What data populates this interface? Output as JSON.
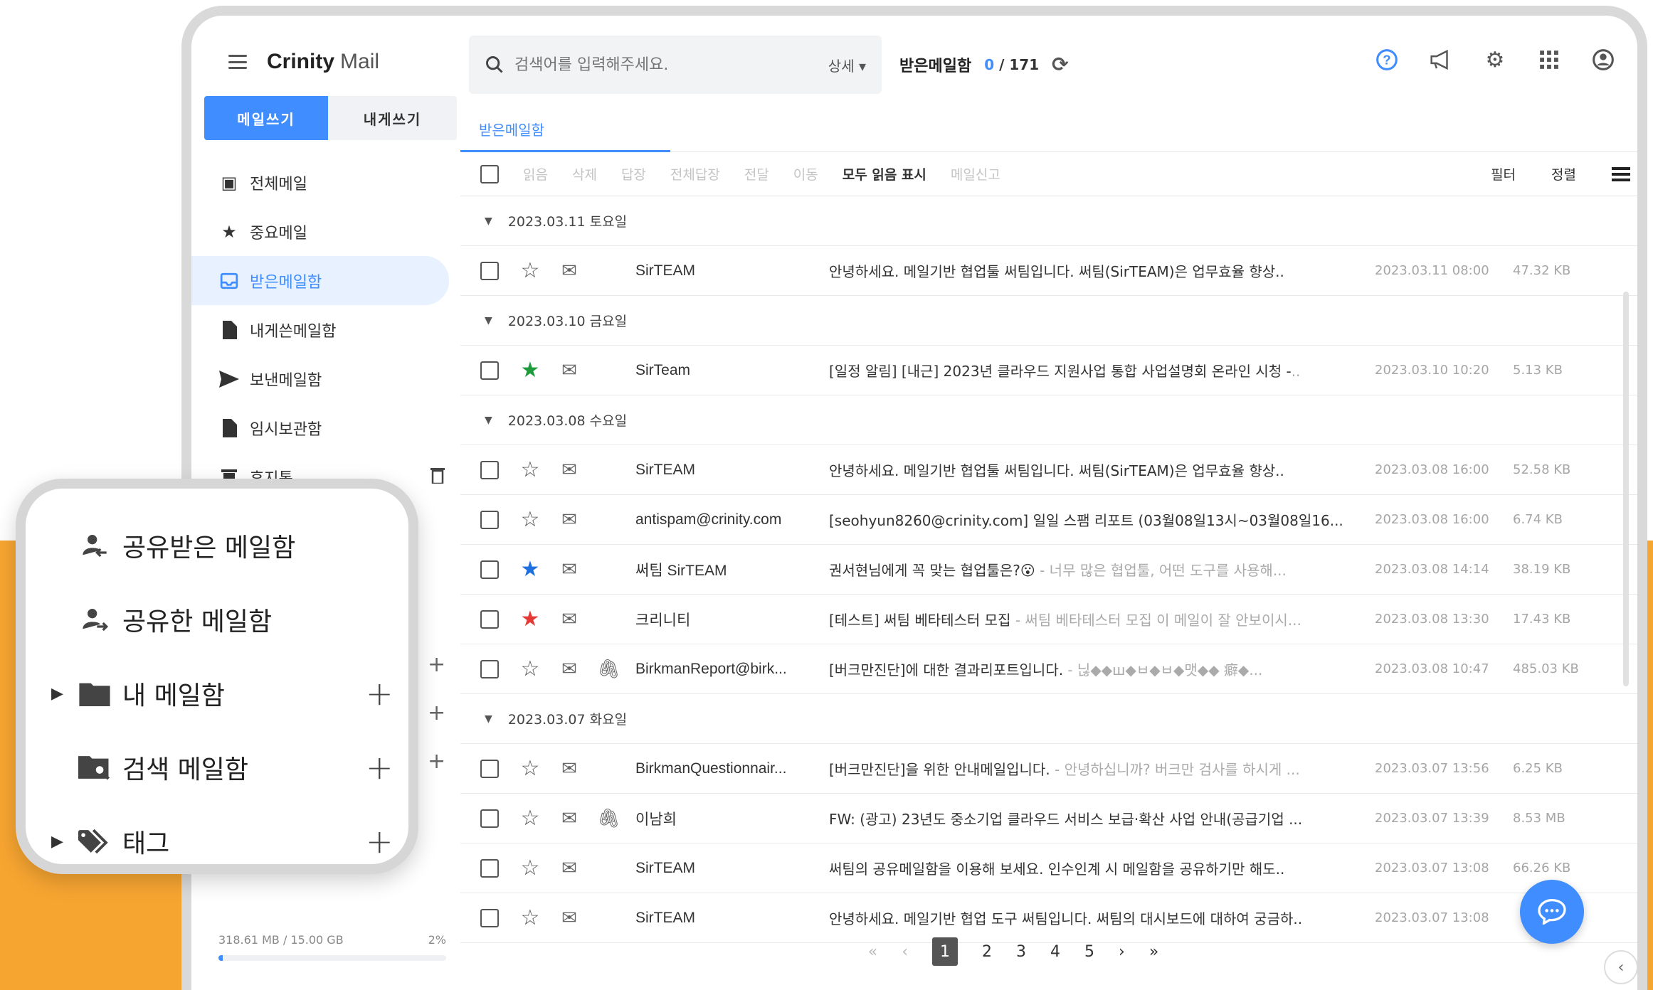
{
  "app": {
    "brand": "Crinity",
    "brand_sub": "Mail"
  },
  "compose": {
    "write_label": "메일쓰기",
    "self_label": "내게쓰기"
  },
  "sidebar": {
    "items": [
      {
        "label": "전체메일",
        "icon": "all-mail-icon"
      },
      {
        "label": "중요메일",
        "icon": "star-icon"
      },
      {
        "label": "받은메일함",
        "icon": "inbox-icon"
      },
      {
        "label": "내게쓴메일함",
        "icon": "document-icon"
      },
      {
        "label": "보낸메일함",
        "icon": "send-icon"
      },
      {
        "label": "임시보관함",
        "icon": "draft-icon"
      },
      {
        "label": "휴지통",
        "icon": "trash-icon"
      }
    ],
    "storage_used": "318.61 MB / 15.00 GB",
    "storage_pct": "2%",
    "storage_fraction": 0.02
  },
  "search": {
    "placeholder": "검색어를 입력해주세요.",
    "detail_label": "상세 ▾"
  },
  "mailbox": {
    "title": "받은메일함",
    "unread": "0",
    "total": "/ 171"
  },
  "tab": {
    "label": "받은메일함"
  },
  "toolbar": {
    "read": "읽음",
    "delete": "삭제",
    "reply": "답장",
    "reply_all": "전체답장",
    "forward": "전달",
    "move": "이동",
    "mark_all_read": "모두 읽음 표시",
    "report_spam": "메일신고",
    "filter": "필터",
    "sort": "정렬"
  },
  "groups": [
    {
      "date": "2023.03.11 토요일",
      "mails": [
        {
          "star": "none",
          "attach": false,
          "sender": "SirTEAM",
          "subject": "안녕하세요. 메일기반 협업툴 써팀입니다. 써팀(SirTEAM)은 업무효율 향상..",
          "preview": "",
          "date": "2023.03.11 08:00",
          "size": "47.32 KB"
        }
      ]
    },
    {
      "date": "2023.03.10 금요일",
      "mails": [
        {
          "star": "green",
          "attach": false,
          "sender": "SirTeam",
          "subject": "[일정 알림] [내근] 2023년 클라우드 지원사업 통합 사업설명회 온라인 시청 -",
          "preview": "..",
          "date": "2023.03.10 10:20",
          "size": "5.13 KB"
        }
      ]
    },
    {
      "date": "2023.03.08 수요일",
      "mails": [
        {
          "star": "none",
          "attach": false,
          "sender": "SirTEAM",
          "subject": "안녕하세요. 메일기반 협업툴 써팀입니다. 써팀(SirTEAM)은 업무효율 향상..",
          "preview": "",
          "date": "2023.03.08 16:00",
          "size": "52.58 KB"
        },
        {
          "star": "none",
          "attach": false,
          "sender": "antispam@crinity.com",
          "subject": "[seohyun8260@crinity.com] 일일 스팸 리포트 (03월08일13시~03월08일16...",
          "preview": "",
          "date": "2023.03.08 16:00",
          "size": "6.74 KB"
        },
        {
          "star": "blue",
          "attach": false,
          "sender": "써팀 SirTEAM",
          "subject": "권서현님에게 꼭 맞는 협업툴은?😮",
          "preview": " - 너무 많은 협업툴, 어떤 도구를 사용해...",
          "date": "2023.03.08 14:14",
          "size": "38.19 KB"
        },
        {
          "star": "red",
          "attach": false,
          "sender": "크리니티",
          "subject": "[테스트] 써팀 베타테스터 모집",
          "preview": " - 써팀 베타테스터 모집 이 메일이 잘 안보이시...",
          "date": "2023.03.08 13:30",
          "size": "17.43 KB"
        },
        {
          "star": "none",
          "attach": true,
          "sender": "BirkmanReport@birk...",
          "subject": "[버크만진단]에 대한 결과리포트입니다.",
          "preview": " - 닎◆◆ш◆ㅂ◆ㅂ◆맷◆◆ 癖◆...",
          "date": "2023.03.08 10:47",
          "size": "485.03 KB"
        }
      ]
    },
    {
      "date": "2023.03.07 화요일",
      "mails": [
        {
          "star": "none",
          "attach": false,
          "sender": "BirkmanQuestionnair...",
          "subject": "[버크만진단]을 위한 안내메일입니다.",
          "preview": " - 안녕하십니까? 버크만 검사를 하시게 ...",
          "date": "2023.03.07 13:56",
          "size": "6.25 KB"
        },
        {
          "star": "none",
          "attach": true,
          "sender": "이남희",
          "subject": "FW: (광고) 23년도 중소기업 클라우드 서비스 보급·확산 사업 안내(공급기업 ...",
          "preview": "",
          "date": "2023.03.07 13:39",
          "size": "8.53 MB"
        },
        {
          "star": "none",
          "attach": false,
          "sender": "SirTEAM",
          "subject": "써팀의 공유메일함을 이용해 보세요. 인수인계 시 메일함을 공유하기만 해도..",
          "preview": "",
          "date": "2023.03.07 13:08",
          "size": "66.26 KB"
        },
        {
          "star": "none",
          "attach": false,
          "sender": "SirTEAM",
          "subject": "안녕하세요. 메일기반 협업 도구 써팀입니다. 써팀의 대시보드에 대하여 궁금하..",
          "preview": "",
          "date": "2023.03.07 13:08",
          "size": ""
        }
      ]
    }
  ],
  "pager": {
    "first": "«",
    "prev": "‹",
    "pages": [
      "1",
      "2",
      "3",
      "4",
      "5"
    ],
    "current": "1",
    "next": "›",
    "last": "»"
  },
  "callout": {
    "items": [
      {
        "label": "공유받은 메일함",
        "icon": "shared-received-icon",
        "caret": false,
        "plus": false
      },
      {
        "label": "공유한 메일함",
        "icon": "shared-by-me-icon",
        "caret": false,
        "plus": false
      },
      {
        "label": "내 메일함",
        "icon": "folder-icon",
        "caret": true,
        "plus": true
      },
      {
        "label": "검색 메일함",
        "icon": "search-folder-icon",
        "caret": false,
        "plus": true
      },
      {
        "label": "태그",
        "icon": "tag-icon",
        "caret": true,
        "plus": true
      }
    ]
  },
  "colors": {
    "accent": "#3f8dff",
    "orange": "#f7a531",
    "star_green": "#1e9b3c",
    "star_blue": "#1e6fe0",
    "star_red": "#e53935"
  }
}
